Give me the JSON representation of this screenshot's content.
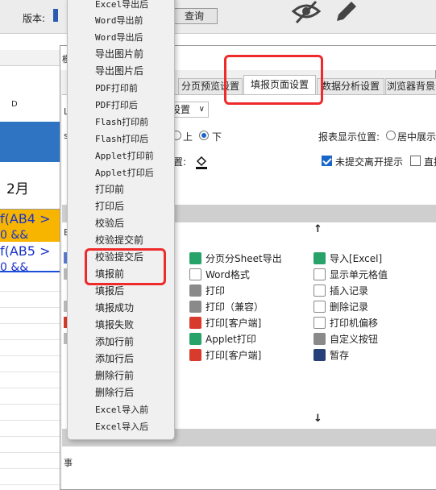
{
  "toolbar": {
    "version_label": "版本:",
    "query_button": "查询"
  },
  "sheet": {
    "column_d": "D",
    "month": "2月",
    "formula1": "f(AB4 >",
    "formula2": "f(AB5 >",
    "formula_tail": "0 &&"
  },
  "dialog": {
    "title": "模",
    "tabs": [
      {
        "label": "分页预览设置",
        "active": false
      },
      {
        "label": "填报页面设置",
        "active": true
      },
      {
        "label": "数据分析设置",
        "active": false
      },
      {
        "label": "浏览器背景",
        "active": false
      }
    ],
    "select_value": "设置",
    "radio_up": "上",
    "radio_down": "下",
    "color_label": "置:",
    "report_pos_label": "报表显示位置:",
    "center_label": "居中展示",
    "unsubmitted_label": "未提交离开提示",
    "direct_label": "直接",
    "left_label_1": "L",
    "left_label_2": "s",
    "left_label_3": "E",
    "bottom_label": "事",
    "buttons": [
      {
        "label": "分页分Sheet导出",
        "icon": "export-excel-icon",
        "color": "green"
      },
      {
        "label": "导入[Excel]",
        "icon": "import-excel-icon",
        "color": "green"
      },
      {
        "label": "Word格式",
        "icon": "word-icon",
        "color": "outline"
      },
      {
        "label": "显示单元格值",
        "icon": "cell-value-icon",
        "color": "outline"
      },
      {
        "label": "打印",
        "icon": "printer-icon",
        "color": "gray"
      },
      {
        "label": "插入记录",
        "icon": "insert-record-icon",
        "color": "outline"
      },
      {
        "label": "打印（兼容）",
        "icon": "printer-compat-icon",
        "color": "gray"
      },
      {
        "label": "删除记录",
        "icon": "delete-record-icon",
        "color": "outline"
      },
      {
        "label": "打印[客户端]",
        "icon": "client-print-icon",
        "color": "red"
      },
      {
        "label": "打印机偏移",
        "icon": "printer-offset-icon",
        "color": "outline"
      },
      {
        "label": "Applet打印",
        "icon": "applet-print-icon",
        "color": "green"
      },
      {
        "label": "自定义按钮",
        "icon": "gear-icon",
        "color": "gray"
      },
      {
        "label": "打印[客户端]",
        "icon": "pdf-print-icon",
        "color": "red"
      },
      {
        "label": "暂存",
        "icon": "save-icon",
        "color": "navy"
      }
    ]
  },
  "menu": {
    "items": [
      "Excel导出后",
      "Word导出前",
      "Word导出后",
      "导出图片前",
      "导出图片后",
      "PDF打印前",
      "PDF打印后",
      "Flash打印前",
      "Flash打印后",
      "Applet打印前",
      "Applet打印后",
      "打印前",
      "打印后",
      "校验后",
      "校验提交前",
      "校验提交后",
      "填报前",
      "填报后",
      "填报成功",
      "填报失败",
      "添加行前",
      "添加行后",
      "删除行前",
      "删除行后",
      "Excel导入前",
      "Excel导入后"
    ]
  },
  "colors": {
    "highlight_box": "#ee2a2a",
    "sheet_blue": "#2f73c3",
    "sheet_yellow": "#f7b500"
  }
}
